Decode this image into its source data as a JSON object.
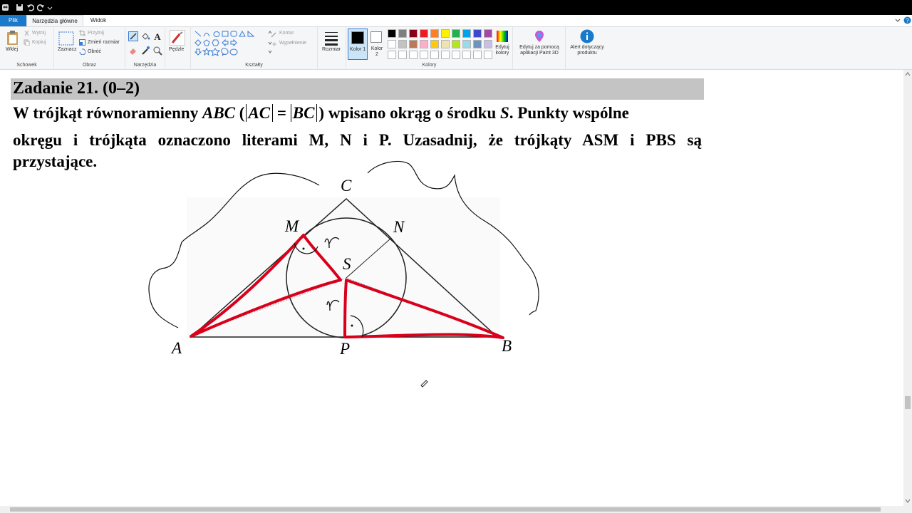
{
  "app": {
    "tabs": [
      "Plik",
      "Narzędzia główne",
      "Widok"
    ]
  },
  "ribbon": {
    "clipboard": {
      "paste": "Wklej",
      "cut": "Wytnij",
      "copy": "Kopiuj",
      "group": "Schowek"
    },
    "image": {
      "select": "Zaznacz",
      "crop": "Przytnij",
      "resize": "Zmień rozmiar",
      "rotate": "Obróć",
      "group": "Obraz"
    },
    "tools": {
      "group": "Narzędzia"
    },
    "brushes": {
      "label": "Pędzle"
    },
    "shapes": {
      "outline": "Kontur",
      "fill": "Wypełnienie",
      "group": "Kształty"
    },
    "size": {
      "label": "Rozmiar"
    },
    "colors": {
      "color1": "Kolor 1",
      "color2": "Kolor 2",
      "edit": "Edytuj kolory",
      "group": "Kolory",
      "row1": [
        "#000000",
        "#7f7f7f",
        "#880015",
        "#ed1c24",
        "#ff7f27",
        "#fff200",
        "#22b14c",
        "#00a2e8",
        "#3f48cc",
        "#a349a4"
      ],
      "row2": [
        "#ffffff",
        "#c3c3c3",
        "#b97a57",
        "#ffaec9",
        "#ffc90e",
        "#efe4b0",
        "#b5e61d",
        "#99d9ea",
        "#7092be",
        "#c8bfe7"
      ]
    },
    "paint3d": "Edytuj za pomocą aplikacji Paint 3D",
    "alert": "Alert dotyczący produktu"
  },
  "document": {
    "task_title": "Zadanie 21. (0–2)",
    "line1_a": "W trójkąt równoramienny ",
    "line1_abc": "ABC",
    "line1_b": " (",
    "line1_ac": "AC",
    "line1_eq": " = ",
    "line1_bc": "BC",
    "line1_c": ") wpisano okrąg o środku ",
    "line1_s": "S",
    "line1_d": ". Punkty wspólne",
    "line2": "okręgu i trójkąta oznaczono literami M, N i P. Uzasadnij, że trójkąty ASM i PBS są",
    "line3": "przystające.",
    "points": {
      "A": "A",
      "B": "B",
      "C": "C",
      "M": "M",
      "N": "N",
      "P": "P",
      "S": "S"
    },
    "annotation": "r"
  }
}
